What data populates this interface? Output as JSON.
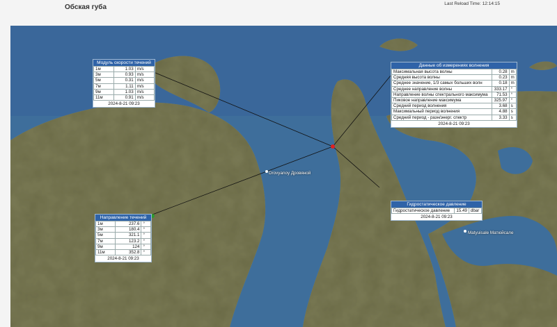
{
  "header": {
    "title": "Обская губа",
    "reload_label": "Last Reload Time:",
    "reload_time": "12:14:15"
  },
  "map": {
    "places": [
      {
        "name": "Drovyanoy Дровяной"
      },
      {
        "name": "Matyuisale Матюйсале"
      }
    ],
    "colors": {
      "water": "#3f6f9c",
      "land": "#7a7a55",
      "panel_header": "#2f63a8",
      "station": "#e02020"
    }
  },
  "current_speed": {
    "title": "Модуль скорости течений",
    "rows": [
      {
        "depth": "1м",
        "value": "1.03",
        "unit": "m/s"
      },
      {
        "depth": "3м",
        "value": "0.93",
        "unit": "m/s"
      },
      {
        "depth": "5м",
        "value": "0.31",
        "unit": "m/s"
      },
      {
        "depth": "7м",
        "value": "1.11",
        "unit": "m/s"
      },
      {
        "depth": "9м",
        "value": "1.03",
        "unit": "m/s"
      },
      {
        "depth": "11м",
        "value": "0.91",
        "unit": "m/s"
      }
    ],
    "timestamp": "2024-8-21 09:23"
  },
  "waves": {
    "title": "Данные об измерениях волнения",
    "rows": [
      {
        "name": "Максимальная высота волны",
        "value": "0.28",
        "unit": "m"
      },
      {
        "name": "Средняя высота волны",
        "value": "0.23",
        "unit": "m"
      },
      {
        "name": "Среднее значение, 1/3 самых больших волн",
        "value": "0.18",
        "unit": "m"
      },
      {
        "name": "Среднее направление волны",
        "value": "333.17",
        "unit": "°"
      },
      {
        "name": "Направление волны спектрального максимума",
        "value": "71.53",
        "unit": "°"
      },
      {
        "name": "Пиковое направление максимума",
        "value": "325.97",
        "unit": "°"
      },
      {
        "name": "Средний период волнения",
        "value": "3.68",
        "unit": "s"
      },
      {
        "name": "Максимальный период волнения",
        "value": "4.88",
        "unit": "s"
      },
      {
        "name": "Средний период - разн/энерг. спектр",
        "value": "3.33",
        "unit": "s"
      }
    ],
    "timestamp": "2024-8-21 09:23"
  },
  "pressure": {
    "title": "Гидростатическое давление",
    "rows": [
      {
        "name": "Гидростатическое давление",
        "value": "15.49",
        "unit": "dbar"
      }
    ],
    "timestamp": "2024-8-21 09:23"
  },
  "current_dir": {
    "title": "Направление течений",
    "rows": [
      {
        "depth": "1м",
        "value": "237.6",
        "unit": "°"
      },
      {
        "depth": "3м",
        "value": "180.4",
        "unit": "°"
      },
      {
        "depth": "5м",
        "value": "321.1",
        "unit": "°"
      },
      {
        "depth": "7м",
        "value": "123.2",
        "unit": "°"
      },
      {
        "depth": "9м",
        "value": "124",
        "unit": "°"
      },
      {
        "depth": "11м",
        "value": "352.8",
        "unit": "°"
      }
    ],
    "timestamp": "2024-8-21 09:23"
  }
}
